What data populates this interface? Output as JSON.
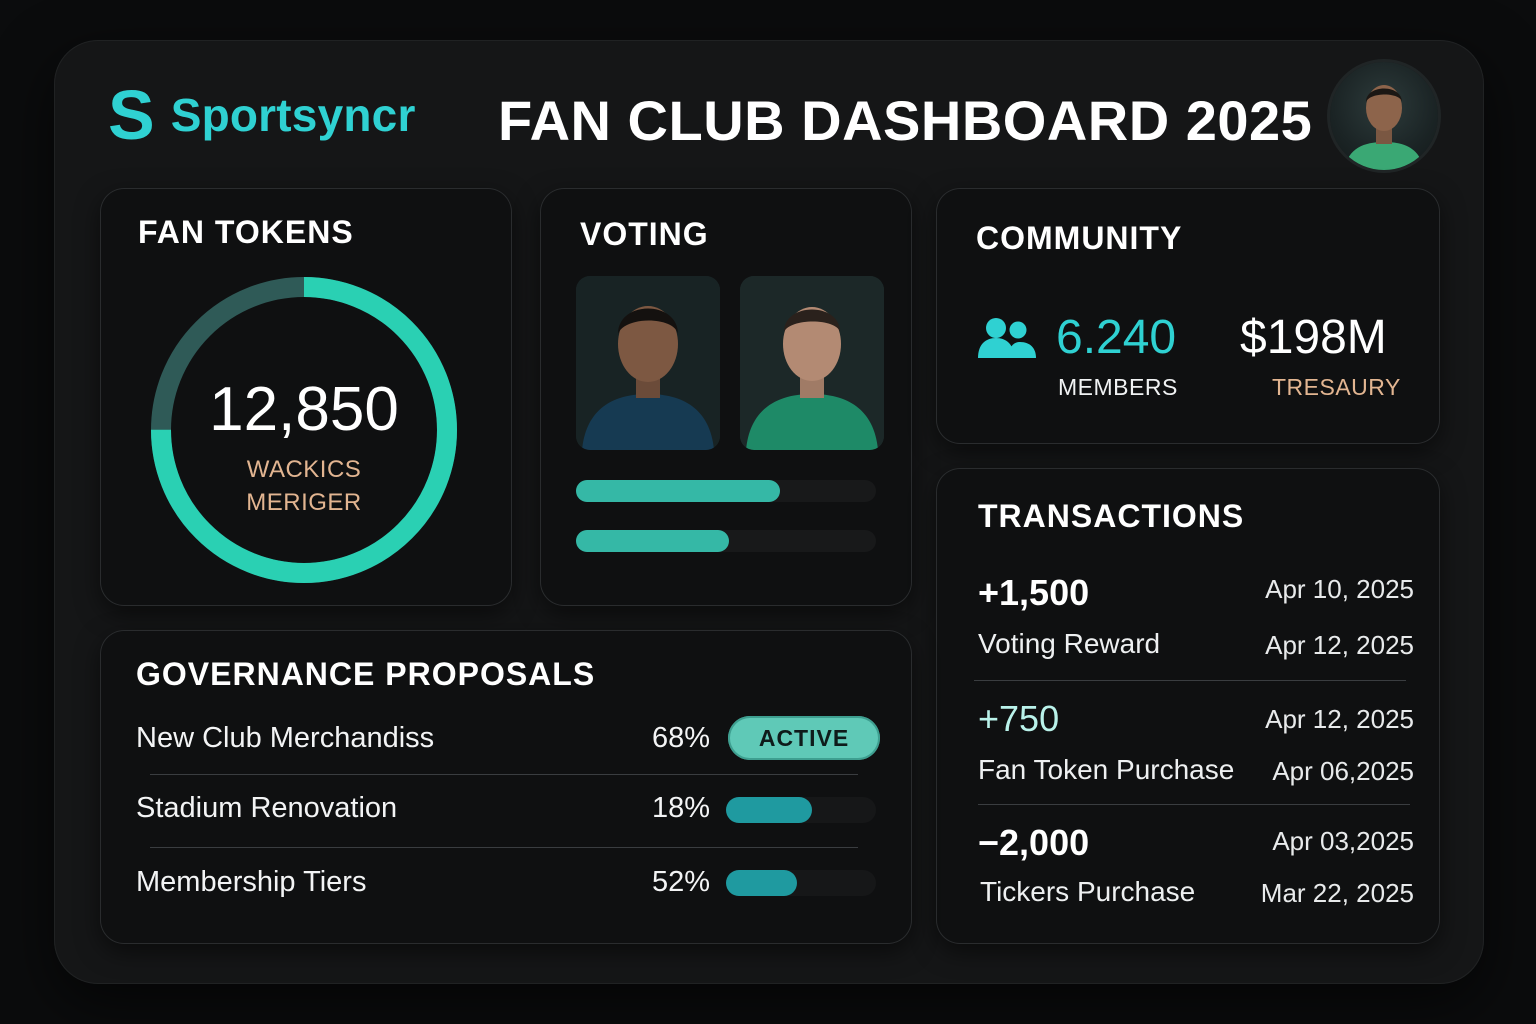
{
  "brand": {
    "mark": "S",
    "name": "Sportsyncr",
    "accent": "#2fd1d2"
  },
  "header": {
    "title": "FAN CLUB DASHBOARD 2025",
    "avatar_icon": "user-avatar-icon"
  },
  "fan_tokens": {
    "title": "FAN TOKENS",
    "value": "12,850",
    "label_line1": "WACKICS",
    "label_line2": "MERIGER",
    "progress_fraction": 0.75,
    "ring_color": "#2ad0b3",
    "ring_track_color": "#2f5a57"
  },
  "voting": {
    "title": "VOTING",
    "candidates": [
      {
        "photo_icon": "player-photo-icon",
        "shirt_color": "#163a52",
        "vote_fraction": 0.68
      },
      {
        "photo_icon": "player-photo-icon",
        "shirt_color": "#1e8a67",
        "vote_fraction": 0.51
      }
    ]
  },
  "community": {
    "title": "COMMUNITY",
    "members_value": "6.240",
    "members_label": "MEMBERS",
    "treasury_value": "$198M",
    "treasury_label": "TRESAURY",
    "members_icon": "people-icon"
  },
  "transactions": {
    "title": "TRANSACTIONS",
    "items": [
      {
        "amount": "+1,500",
        "desc": "Voting Reward",
        "date1": "Apr 10, 2025",
        "date2": "Apr 12, 2025"
      },
      {
        "amount": "+750",
        "desc": "Fan Token Purchase",
        "date1": "Apr 12, 2025",
        "date2": "Apr 06,2025"
      },
      {
        "amount": "−2,000",
        "desc": "Tickers Purchase",
        "date1": "Apr 03,2025",
        "date2": "Mar 22, 2025"
      }
    ]
  },
  "governance": {
    "title": "GOVERNANCE PROPOSALS",
    "proposals": [
      {
        "name": "New Club Merchandiss",
        "percent": "68%",
        "status": "ACTIVE"
      },
      {
        "name": "Stadium Renovation",
        "percent": "18%",
        "fraction": 0.57
      },
      {
        "name": "Membership Tiers",
        "percent": "52%",
        "fraction": 0.47
      }
    ]
  }
}
